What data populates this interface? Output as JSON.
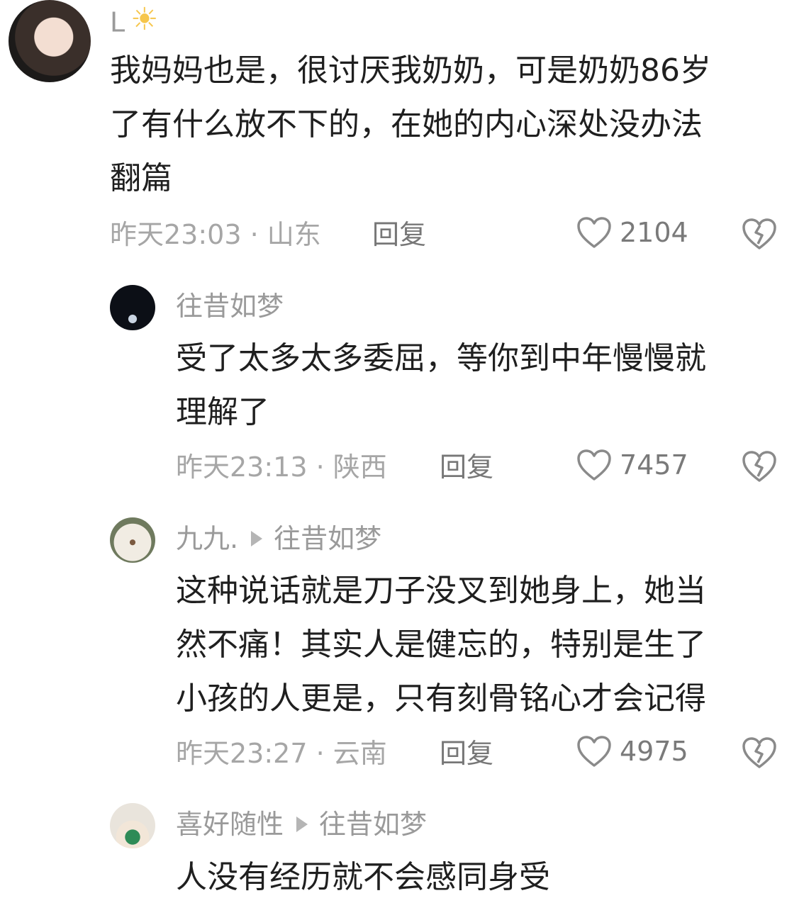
{
  "comments": [
    {
      "username": "L",
      "content": "我妈妈也是，很讨厌我奶奶，可是奶奶86岁\n了有什么放不下的，在她的内心深处没办法\n翻篇",
      "time_location": "昨天23:03 · 山东",
      "reply_label": "回复",
      "likes": "2104"
    },
    {
      "username": "往昔如梦",
      "content": "受了太多太多委屈，等你到中年慢慢就\n理解了",
      "time_location": "昨天23:13 · 陕西",
      "reply_label": "回复",
      "likes": "7457"
    },
    {
      "username": "九九.",
      "reply_to": "往昔如梦",
      "content": "这种说话就是刀子没叉到她身上，她当\n然不痛！其实人是健忘的，特别是生了\n小孩的人更是，只有刻骨铭心才会记得",
      "time_location": "昨天23:27 · 云南",
      "reply_label": "回复",
      "likes": "4975"
    },
    {
      "username": "喜好随性",
      "reply_to": "往昔如梦",
      "content": "人没有经历就不会感同身受"
    }
  ],
  "icons": {
    "like": "heart-outline-icon",
    "dislike": "broken-heart-icon",
    "reply_arrow": "triangle-right-icon",
    "sun": "sun-icon"
  },
  "colors": {
    "meta_text": "#a6a6a6",
    "username": "#9a9a9a",
    "body_text": "#1f1f1f"
  }
}
